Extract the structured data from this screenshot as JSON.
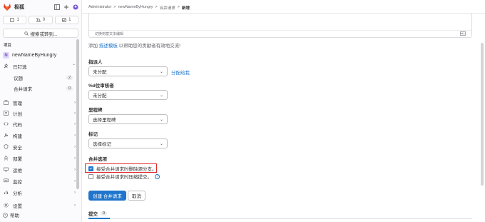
{
  "sidebar": {
    "brand": "极狐",
    "counters": [
      {
        "icon": "issues-icon",
        "count": "1"
      },
      {
        "icon": "merge-request-icon",
        "count": "0"
      },
      {
        "icon": "todo-icon",
        "count": "1"
      }
    ],
    "search_label": "搜索或转到...",
    "section_label": "项目",
    "project_initial": "N",
    "project_name": "newNameByHungry",
    "pinned_label": "已钉选",
    "pinned_items": [
      {
        "label": "议题",
        "count": "2"
      },
      {
        "label": "合并请求",
        "count": "0"
      }
    ],
    "nav_items": [
      {
        "label": "管理",
        "icon": "manage-icon"
      },
      {
        "label": "计划",
        "icon": "plan-icon"
      },
      {
        "label": "代码",
        "icon": "code-icon"
      },
      {
        "label": "构建",
        "icon": "build-icon"
      },
      {
        "label": "安全",
        "icon": "shield-icon"
      },
      {
        "label": "部署",
        "icon": "deploy-icon"
      },
      {
        "label": "运维",
        "icon": "operate-icon"
      },
      {
        "label": "监控",
        "icon": "monitor-icon"
      },
      {
        "label": "分析",
        "icon": "analytics-icon"
      },
      {
        "label": "设置",
        "icon": "gear-icon"
      }
    ],
    "help_label": "帮助"
  },
  "breadcrumb": [
    "Administrator",
    "newNameByHungry",
    "合并请求",
    "新增"
  ],
  "editor": {
    "footer_hint": "切换到富文本编辑",
    "md_icon": "markdown-icon"
  },
  "template_hint": {
    "prefix": "添加",
    "link": "描述模板",
    "suffix": "以帮助您的贡献者有效地交流!"
  },
  "form": {
    "assignee_label": "指派人",
    "assignee_value": "未分配",
    "assign_me": "分配给我",
    "reviewer_label": "%d位审核者",
    "reviewer_value": "未分配",
    "milestone_label": "里程碑",
    "milestone_value": "选择里程碑",
    "labels_label": "标记",
    "labels_value": "选择标记",
    "merge_options_label": "合并选项",
    "option_delete_branch": "接受合并请求时删除源分支。",
    "option_squash": "接受合并请求时压缩提交。"
  },
  "buttons": {
    "create": "创建 合并请求",
    "cancel": "取消"
  },
  "tabs": [
    {
      "label": "提交",
      "count": "0"
    }
  ],
  "colors": {
    "accent": "#1f75cb",
    "highlight": "#e0282e"
  }
}
